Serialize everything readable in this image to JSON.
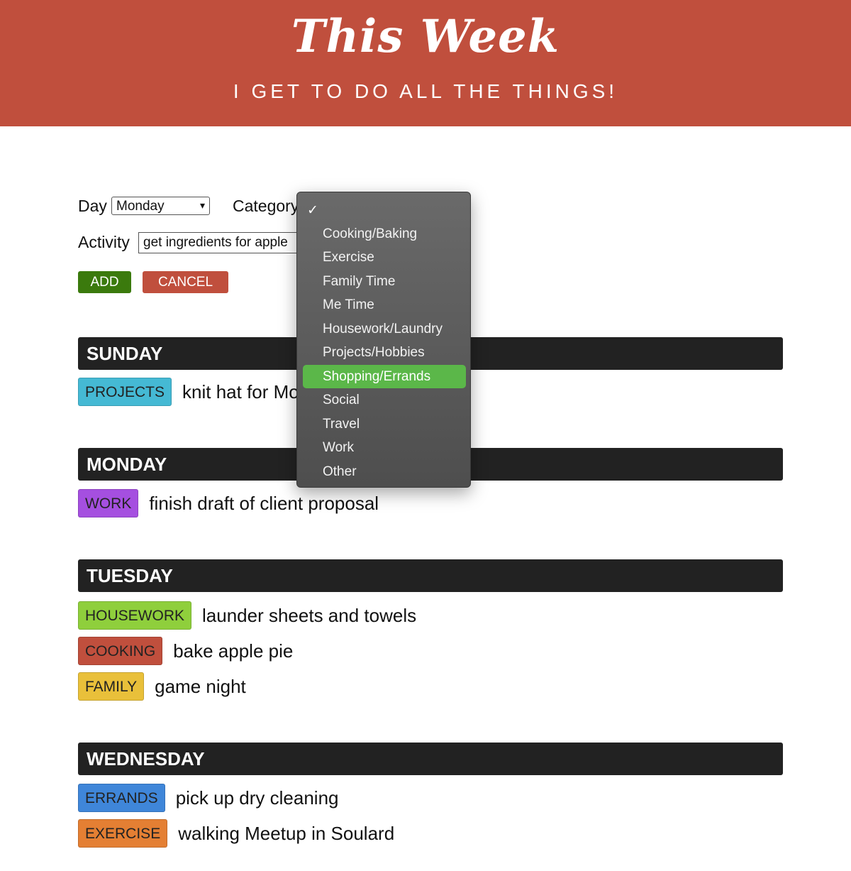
{
  "header": {
    "title": "This Week",
    "subtitle": "I GET TO DO ALL THE THINGS!"
  },
  "form": {
    "day_label": "Day",
    "day_value": "Monday",
    "category_label": "Category",
    "activity_label": "Activity",
    "activity_value": "get ingredients for apple",
    "add_label": "ADD",
    "cancel_label": "CANCEL"
  },
  "category_dropdown": {
    "check": "✓",
    "selected": "Shopping/Errands",
    "options": [
      "Cooking/Baking",
      "Exercise",
      "Family Time",
      "Me Time",
      "Housework/Laundry",
      "Projects/Hobbies",
      "Shopping/Errands",
      "Social",
      "Travel",
      "Work",
      "Other"
    ]
  },
  "days": [
    {
      "name": "SUNDAY",
      "items": [
        {
          "tag": "PROJECTS",
          "color": "#45b9d4",
          "text": "knit hat for Mom"
        }
      ]
    },
    {
      "name": "MONDAY",
      "items": [
        {
          "tag": "WORK",
          "color": "#a54fe0",
          "text": "finish draft of client proposal"
        }
      ]
    },
    {
      "name": "TUESDAY",
      "items": [
        {
          "tag": "HOUSEWORK",
          "color": "#8fcf3c",
          "text": "launder sheets and towels"
        },
        {
          "tag": "COOKING",
          "color": "#c04f3d",
          "text": "bake apple pie"
        },
        {
          "tag": "FAMILY",
          "color": "#e9c03a",
          "text": "game night"
        }
      ]
    },
    {
      "name": "WEDNESDAY",
      "items": [
        {
          "tag": "ERRANDS",
          "color": "#3f86d9",
          "text": "pick up dry cleaning"
        },
        {
          "tag": "EXERCISE",
          "color": "#e47f33",
          "text": "walking Meetup in Soulard"
        }
      ]
    }
  ]
}
